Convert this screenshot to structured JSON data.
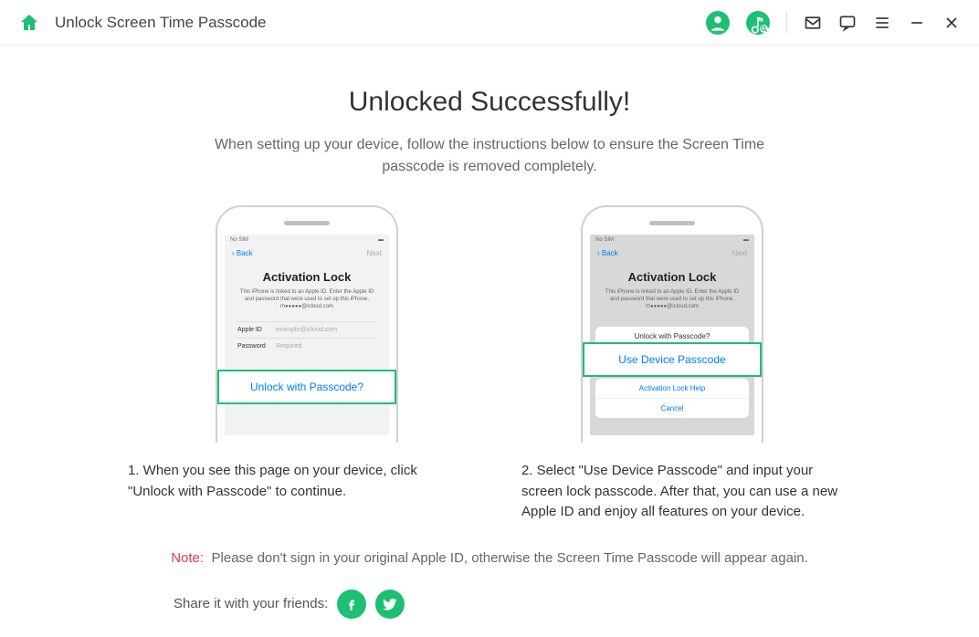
{
  "header": {
    "title": "Unlock Screen Time Passcode"
  },
  "main": {
    "title": "Unlocked Successfully!",
    "subtitle": "When setting up your device, follow the instructions below to ensure the Screen Time passcode is removed completely.",
    "phone1": {
      "status": "No SIM",
      "back": "Back",
      "next": "Next",
      "title": "Activation Lock",
      "desc": "This iPhone is linked to an Apple ID. Enter the Apple ID and password that were used to set up this iPhone. m●●●●●@icloud.com",
      "apple_id_label": "Apple ID",
      "apple_id_placeholder": "example@icloud.com",
      "password_label": "Password",
      "password_placeholder": "Required",
      "highlight": "Unlock with Passcode?"
    },
    "phone2": {
      "status": "No SIM",
      "back": "Back",
      "next": "Next",
      "title": "Activation Lock",
      "desc": "This iPhone is linked to an Apple ID. Enter the Apple ID and password that were used to set up this iPhone. m●●●●●@icloud.com",
      "menu_unlock": "Unlock with Passcode?",
      "highlight": "Use Device Passcode",
      "menu_help": "Activation Lock Help",
      "menu_cancel": "Cancel"
    },
    "instruction1": "1. When you see this page on your device, click \"Unlock with Passcode\" to continue.",
    "instruction2": "2. Select \"Use Device Passcode\" and input your screen lock passcode. After that, you can use a new Apple ID and enjoy all features on your device.",
    "note_label": "Note:",
    "note_text": "Please don't sign in your original Apple ID, otherwise the Screen Time Passcode will appear again.",
    "share_text": "Share it with your friends:"
  }
}
